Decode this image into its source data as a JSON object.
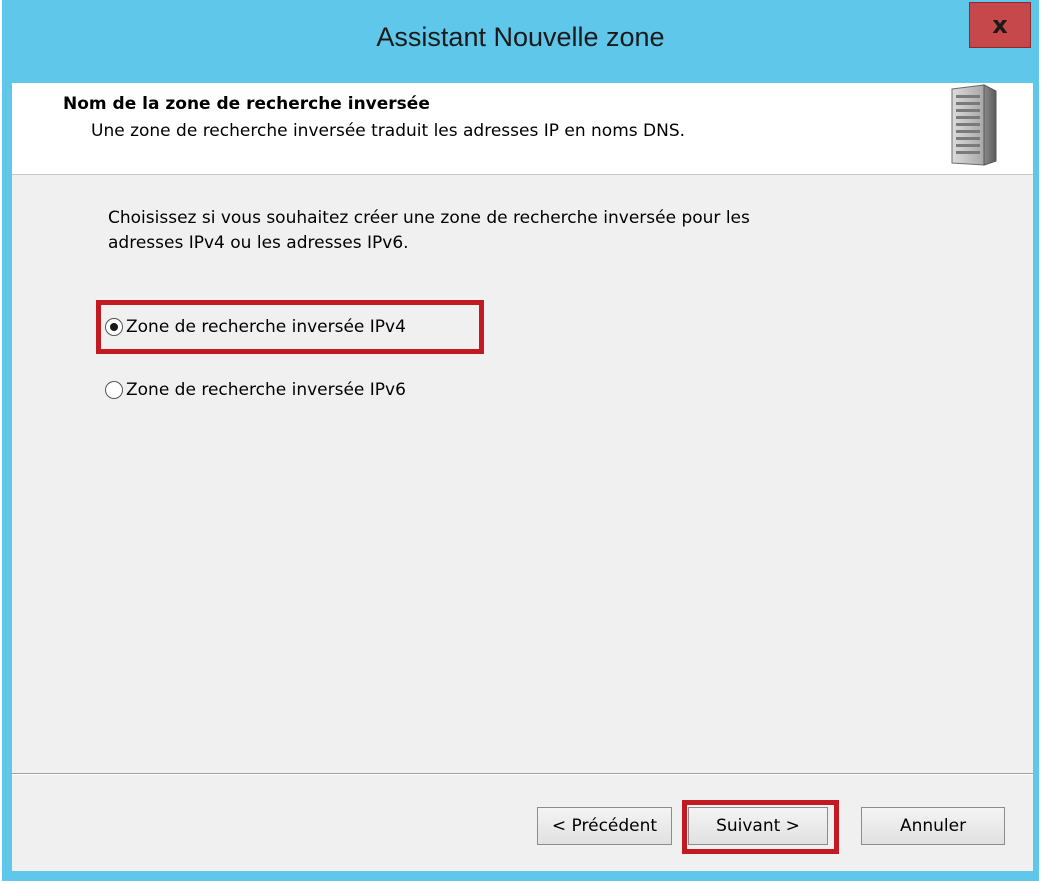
{
  "window": {
    "title": "Assistant Nouvelle zone",
    "close_label": "x"
  },
  "header": {
    "title": "Nom de la zone de recherche inversée",
    "description": "Une zone de recherche inversée traduit les adresses IP en noms DNS.",
    "icon": "server-icon"
  },
  "body": {
    "intro_line1": "Choisissez si vous souhaitez créer une zone de recherche inversée pour les",
    "intro_line2": "adresses IPv4 ou les adresses IPv6.",
    "options": [
      {
        "label": "Zone de recherche inversée IPv4",
        "selected": true
      },
      {
        "label": "Zone de recherche inversée IPv6",
        "selected": false
      }
    ]
  },
  "buttons": {
    "back": "< Précédent",
    "next": "Suivant >",
    "cancel": "Annuler"
  },
  "colors": {
    "frame": "#5ec7ea",
    "close_button": "#c7484a",
    "highlight": "#c21a23",
    "client_background": "#f0f0f0"
  }
}
